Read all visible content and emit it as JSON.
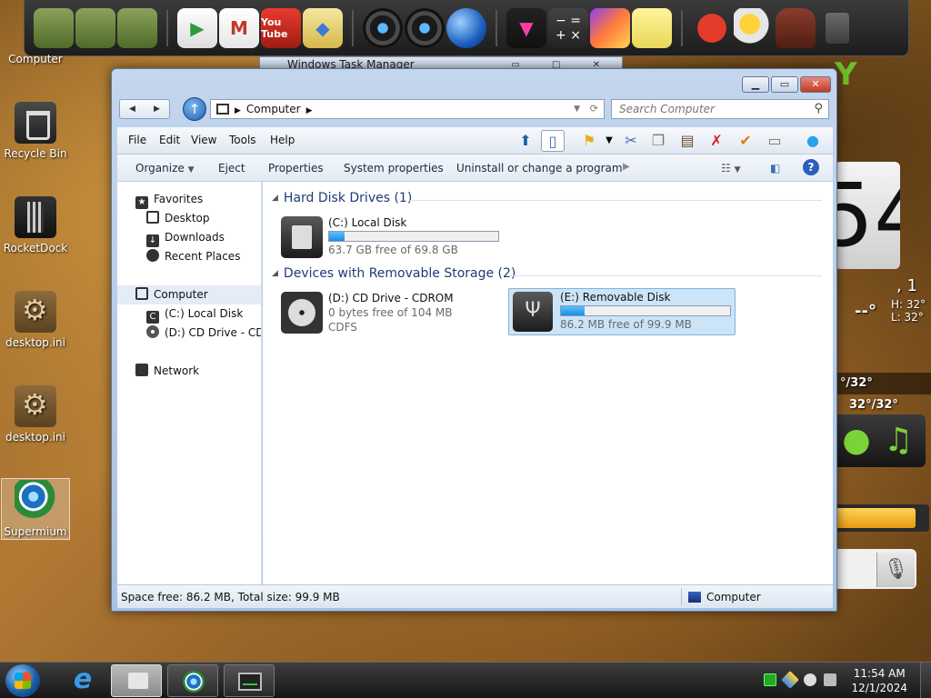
{
  "desktop": {
    "icons": [
      {
        "label": "Computer"
      },
      {
        "label": "Recycle Bin"
      },
      {
        "label": "RocketDock"
      },
      {
        "label": "desktop.ini"
      },
      {
        "label": "desktop.ini"
      },
      {
        "label": "Supermium"
      }
    ],
    "widgets": {
      "clock_digit": "54",
      "date": ", 1",
      "temp": "--°",
      "high": "H: 32°",
      "low": "L: 32°",
      "forecast_a": "°/32°",
      "forecast_b": "32°/32°",
      "progress": 0.86,
      "green_stroke": "Y",
      "music": "♫"
    }
  },
  "dock": {
    "icons": [
      "folder-android-icon",
      "globe-folder-icon",
      "folder-icon",
      "play-store-icon",
      "gmail-icon",
      "youtube-icon",
      "maps-icon",
      "camera-icon",
      "speaker-icon",
      "browser-globe-icon",
      "video-icon",
      "calculator-icon",
      "gallery-icon",
      "notes-icon",
      "angry-birds-icon",
      "weather-icon",
      "android-icon",
      "trash-icon"
    ],
    "youtube_label": "You Tube"
  },
  "taskmanager": {
    "title": "Windows Task Manager"
  },
  "window": {
    "address": "Computer",
    "search_placeholder": "Search Computer",
    "menu": [
      "File",
      "Edit",
      "View",
      "Tools",
      "Help"
    ],
    "commands": {
      "organize": "Organize",
      "eject": "Eject",
      "properties": "Properties",
      "system_properties": "System properties",
      "uninstall": "Uninstall or change a program"
    },
    "nav": {
      "favorites": "Favorites",
      "desktop": "Desktop",
      "downloads": "Downloads",
      "recent": "Recent Places",
      "computer": "Computer",
      "local_disk": "(C:) Local Disk",
      "cd_drive": "(D:) CD Drive - CDROM",
      "network": "Network"
    },
    "groups": {
      "hdd": "Hard Disk Drives (1)",
      "removable": "Devices with Removable Storage (2)"
    },
    "drives": {
      "c": {
        "name": "(C:) Local Disk",
        "free": "63.7 GB free of 69.8 GB",
        "used_fraction": 0.09
      },
      "d": {
        "name": "(D:) CD Drive - CDROM",
        "free": "0 bytes free of 104 MB",
        "fs": "CDFS"
      },
      "e": {
        "name": "(E:) Removable Disk",
        "free": "86.2 MB free of 99.9 MB",
        "used_fraction": 0.14
      }
    },
    "status": {
      "space": "Space free: 86.2 MB, Total size: 99.9 MB",
      "location": "Computer"
    }
  },
  "taskbar": {
    "time": "11:54 AM",
    "date": "12/1/2024",
    "ie_glyph": "e"
  }
}
